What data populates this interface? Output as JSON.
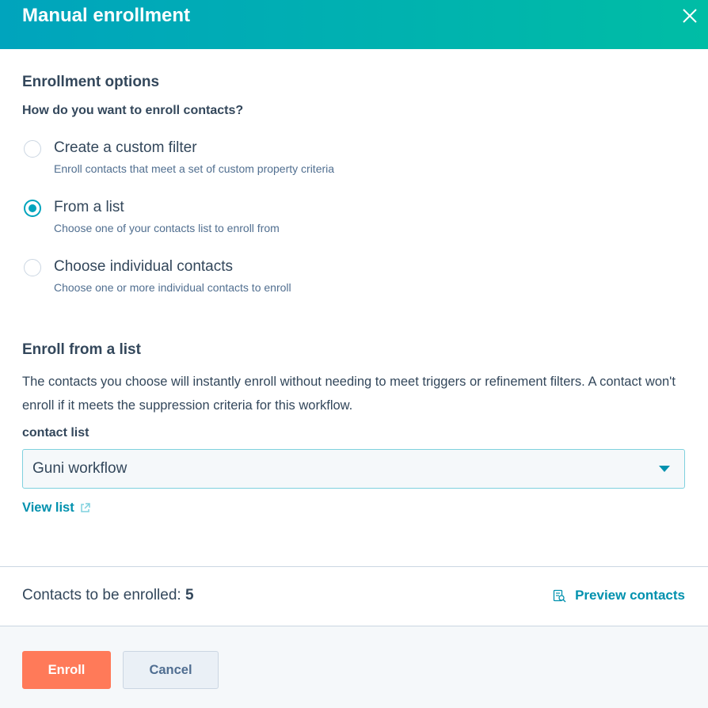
{
  "header": {
    "title": "Manual enrollment",
    "close_icon": "close-icon",
    "gradient_start": "#00a4bd",
    "gradient_end": "#00bda5"
  },
  "enrollment_options": {
    "title": "Enrollment options",
    "question": "How do you want to enroll contacts?",
    "options": [
      {
        "label": "Create a custom filter",
        "description": "Enroll contacts that meet a set of custom property criteria",
        "selected": false
      },
      {
        "label": "From a list",
        "description": "Choose one of your contacts list to enroll from",
        "selected": true
      },
      {
        "label": "Choose individual contacts",
        "description": "Choose one or more individual contacts to enroll",
        "selected": false
      }
    ]
  },
  "enroll_from_list": {
    "title": "Enroll from a list",
    "description": "The contacts you choose will instantly enroll without needing to meet triggers or refinement filters. A contact won't enroll if it meets the suppression criteria for this workflow.",
    "field_label": "contact list",
    "selected_list": "Guni workflow",
    "view_list_label": "View list"
  },
  "summary": {
    "label": "Contacts to be enrolled:",
    "count": "5",
    "preview_label": "Preview contacts"
  },
  "footer": {
    "enroll_label": "Enroll",
    "cancel_label": "Cancel"
  },
  "colors": {
    "accent": "#00a4bd",
    "link": "#0091ae",
    "primary_button": "#ff7a59",
    "text": "#33475b"
  }
}
